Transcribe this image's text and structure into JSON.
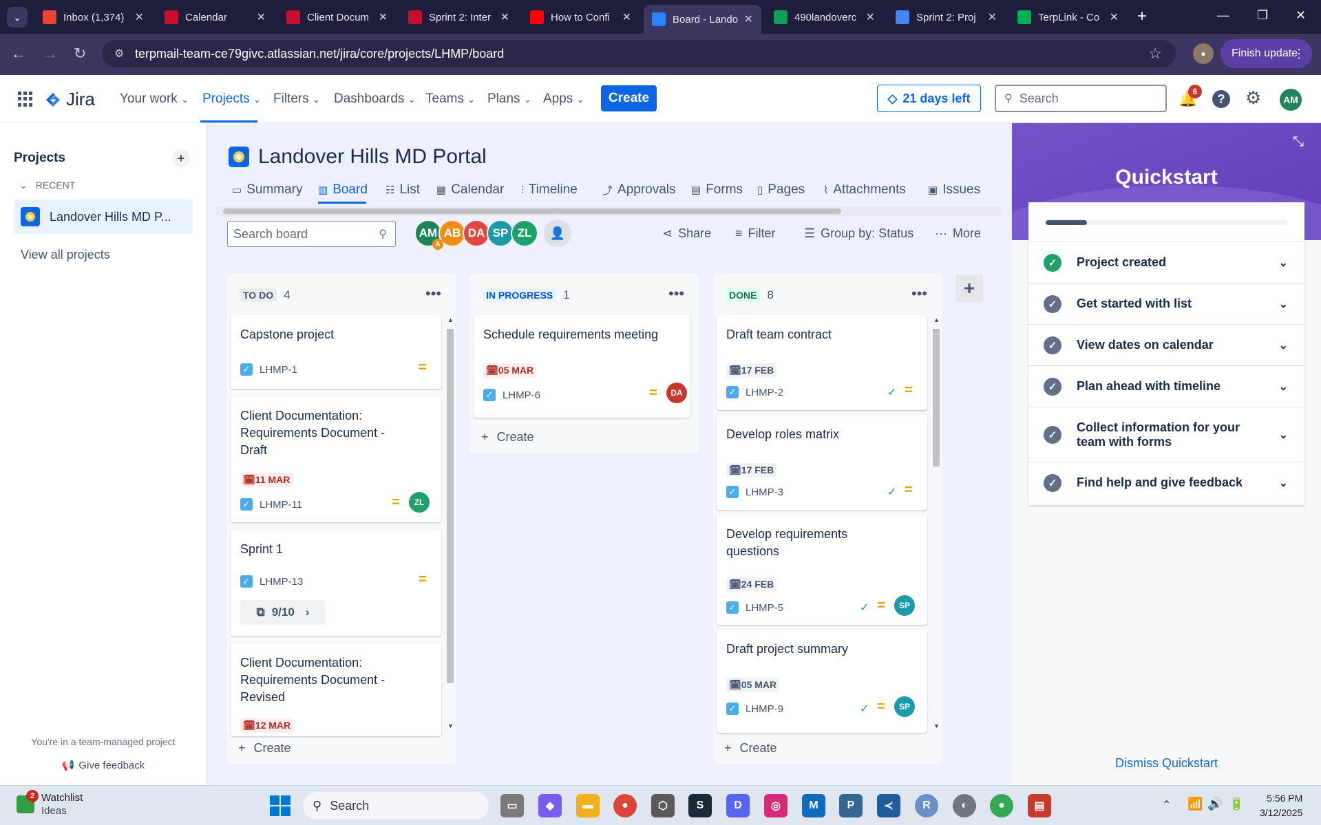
{
  "browser": {
    "tabs": [
      {
        "title": "Inbox (1,374)",
        "icon": "gmail-icon",
        "color": "#ea4335"
      },
      {
        "title": "Calendar",
        "icon": "umd-icon",
        "color": "#c8102e"
      },
      {
        "title": "Client Docum",
        "icon": "umd-icon",
        "color": "#c8102e"
      },
      {
        "title": "Sprint 2: Inter",
        "icon": "umd-icon",
        "color": "#c8102e"
      },
      {
        "title": "How to Confi",
        "icon": "youtube-icon",
        "color": "#ff0000"
      },
      {
        "title": "Board - Lando",
        "icon": "jira-icon",
        "color": "#2684ff"
      },
      {
        "title": "490landoverc",
        "icon": "drive-icon",
        "color": "#0f9d58"
      },
      {
        "title": "Sprint 2: Proj",
        "icon": "docs-icon",
        "color": "#4285f4"
      },
      {
        "title": "TerpLink - Co",
        "icon": "terplink-icon",
        "color": "#00b050"
      }
    ],
    "url": "terpmail-team-ce79givc.atlassian.net/jira/core/projects/LHMP/board",
    "finish_update": "Finish update"
  },
  "header": {
    "logo": "Jira",
    "nav": [
      "Your work",
      "Projects",
      "Filters",
      "Dashboards",
      "Teams",
      "Plans",
      "Apps"
    ],
    "create": "Create",
    "trial": "21 days left",
    "search_placeholder": "Search",
    "notifications": "6",
    "user_initials": "AM"
  },
  "sidebar": {
    "title": "Projects",
    "recent": "RECENT",
    "project": "Landover Hills MD P...",
    "view_all": "View all projects",
    "footer_note": "You're in a team-managed project",
    "feedback": "Give feedback"
  },
  "project": {
    "title": "Landover Hills MD Portal",
    "tabs": [
      "Summary",
      "Board",
      "List",
      "Calendar",
      "Timeline",
      "Approvals",
      "Forms",
      "Pages",
      "Attachments",
      "Issues"
    ],
    "search_placeholder": "Search board",
    "avatars": [
      {
        "initials": "AM",
        "color": "#1f845a"
      },
      {
        "initials": "AB",
        "color": "#f18d13"
      },
      {
        "initials": "DA",
        "color": "#e2483d"
      },
      {
        "initials": "SP",
        "color": "#1d9aaa"
      },
      {
        "initials": "ZL",
        "color": "#22a06b"
      }
    ],
    "avatar_badge": "A",
    "share": "Share",
    "filter": "Filter",
    "group_by": "Group by: Status",
    "more": "More"
  },
  "columns": [
    {
      "name": "TO DO",
      "count": "4",
      "cards": [
        {
          "title": "Capstone project",
          "key": "LHMP-1"
        },
        {
          "title": "Client Documentation: Requirements Document - Draft",
          "due": "11 MAR",
          "key": "LHMP-11",
          "assignee": "ZL"
        },
        {
          "title": "Sprint 1",
          "key": "LHMP-13",
          "subtasks": "9/10"
        },
        {
          "title": "Client Documentation: Requirements Document - Revised",
          "due": "12 MAR"
        }
      ],
      "create": "Create"
    },
    {
      "name": "IN PROGRESS",
      "count": "1",
      "cards": [
        {
          "title": "Schedule requirements meeting",
          "due": "05 MAR",
          "key": "LHMP-6",
          "assignee": "DA"
        }
      ],
      "create": "Create"
    },
    {
      "name": "DONE",
      "count": "8",
      "cards": [
        {
          "title": "Draft team contract",
          "due": "17 FEB",
          "key": "LHMP-2"
        },
        {
          "title": "Develop roles matrix",
          "due": "17 FEB",
          "key": "LHMP-3"
        },
        {
          "title": "Develop requirements questions",
          "due": "24 FEB",
          "key": "LHMP-5",
          "assignee": "SP"
        },
        {
          "title": "Draft project summary",
          "due": "05 MAR",
          "key": "LHMP-9",
          "assignee": "SP"
        }
      ],
      "create": "Create"
    }
  ],
  "quickstart": {
    "title": "Quickstart",
    "progress": 0.17,
    "items": [
      {
        "label": "Project created",
        "done": true
      },
      {
        "label": "Get started with list",
        "done": false
      },
      {
        "label": "View dates on calendar",
        "done": false
      },
      {
        "label": "Plan ahead with timeline",
        "done": false
      },
      {
        "label": "Collect information for your team with forms",
        "done": false
      },
      {
        "label": "Find help and give feedback",
        "done": false
      }
    ],
    "dismiss": "Dismiss Quickstart"
  },
  "taskbar": {
    "widget_title": "Watchlist",
    "widget_sub": "Ideas",
    "widget_badge": "2",
    "search": "Search",
    "time": "5:56 PM",
    "date": "3/12/2025"
  }
}
